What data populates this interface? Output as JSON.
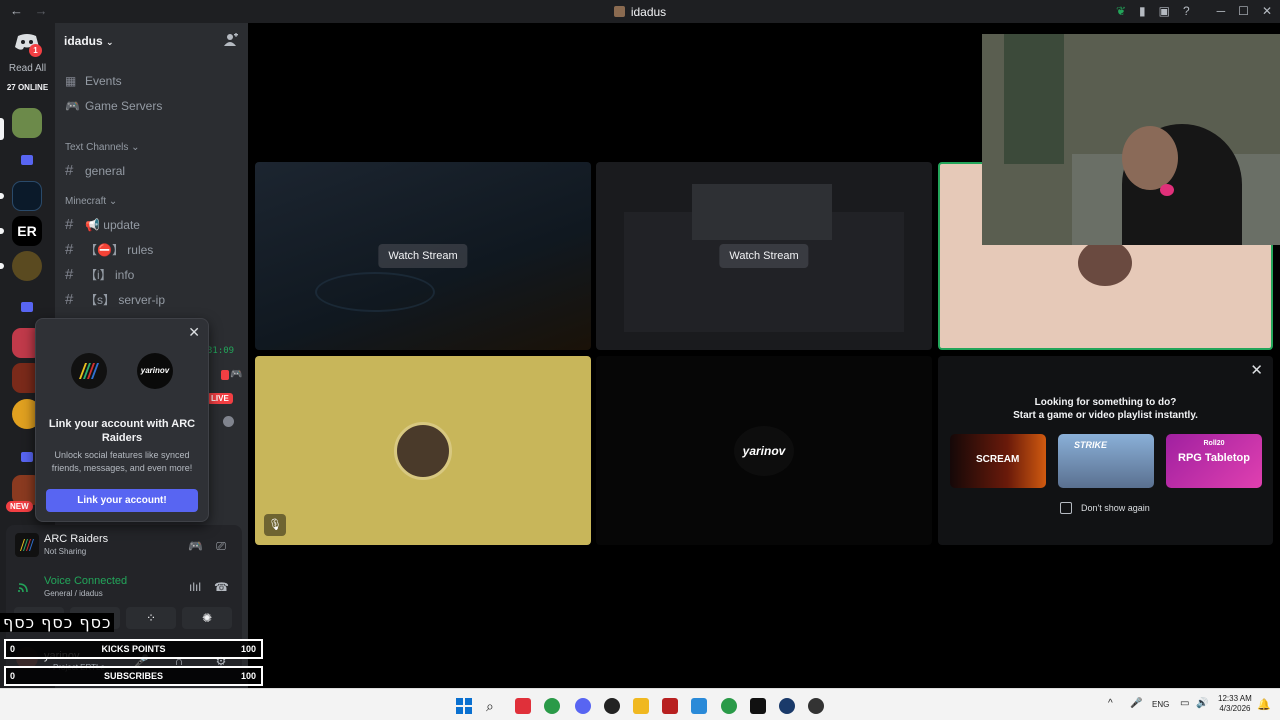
{
  "titlebar": {
    "title": "idadus",
    "back": "←",
    "forward": "→"
  },
  "rail": {
    "badge": "1",
    "read_all": "Read All",
    "online": "27 ONLINE",
    "new_badge": "NEW"
  },
  "sidebar": {
    "server_name": "idadus",
    "events": "Events",
    "game_servers": "Game Servers",
    "cat_text": "Text Channels",
    "ch_general": "general",
    "cat_minecraft": "Minecraft",
    "ch_update": "📢 update",
    "ch_rules": "【⛔】 rules",
    "ch_info": "【i】 info",
    "ch_server_ip": "【s】 server-ip",
    "timer": "31:09",
    "live": "LIVE"
  },
  "popup": {
    "title": "Link your account with ARC Raiders",
    "subtitle": "Unlock social features like synced friends, messages, and even more!",
    "button": "Link your account!",
    "logo2": "yarinov"
  },
  "panel": {
    "game": "ARC Raiders",
    "game_status": "Not Sharing",
    "voice": "Voice Connected",
    "voice_sub": "General / idadus",
    "user": "yarinov",
    "user_sub": "• Project ERTLe"
  },
  "overlay": {
    "hebrew": "כסף כסף כסף",
    "kicks_label": "KICKS POINTS",
    "kicks_left": "0",
    "kicks_right": "100",
    "subs_label": "SUBSCRIBES",
    "subs_left": "0",
    "subs_right": "100"
  },
  "stage": {
    "watch1": "Watch Stream",
    "watch2": "Watch Stream",
    "tile_name": "yarinov"
  },
  "suggest": {
    "line1": "Looking for something to do?",
    "line2": "Start a game or video playlist instantly.",
    "card1": "SCREAM",
    "card2": "STRIKE",
    "card3_top": "Roll20",
    "card3": "RPG Tabletop",
    "dont_show": "Don't show again"
  },
  "taskbar": {
    "lang": "ENG",
    "time": "12:33 AM",
    "date": "4/3/2026"
  },
  "colors": {
    "blurple": "#5865f2",
    "green": "#23a55a",
    "red": "#f23f43",
    "sidebar": "#2b2d31",
    "rail": "#1e1f22"
  }
}
